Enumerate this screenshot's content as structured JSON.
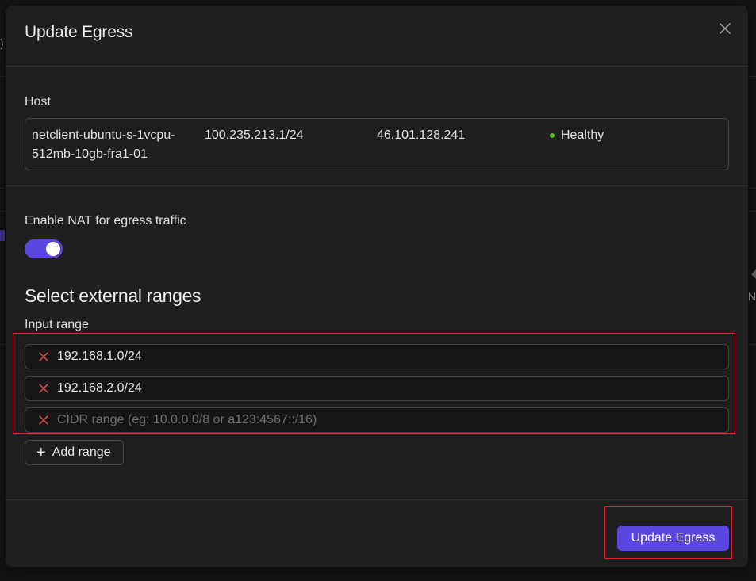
{
  "modal": {
    "title": "Update Egress"
  },
  "host": {
    "label": "Host",
    "name": "netclient-ubuntu-s-1vcpu-512mb-10gb-fra1-01",
    "address": "100.235.213.1/24",
    "public_ip": "46.101.128.241",
    "status": "Healthy",
    "status_color": "#52c41a"
  },
  "nat": {
    "label": "Enable NAT for egress traffic",
    "enabled": true
  },
  "ranges": {
    "title": "Select external ranges",
    "input_label": "Input range",
    "items": [
      {
        "value": "192.168.1.0/24"
      },
      {
        "value": "192.168.2.0/24"
      }
    ],
    "new_placeholder": "CIDR range (eg: 10.0.0.0/8 or a123:4567::/16)",
    "add_label": "Add range"
  },
  "footer": {
    "submit_label": "Update Egress"
  },
  "background": {
    "left_stub": ")",
    "right_stub": "N"
  },
  "colors": {
    "accent": "#5b46e0",
    "danger": "#e5484d",
    "highlight_frame": "#d8262c"
  }
}
